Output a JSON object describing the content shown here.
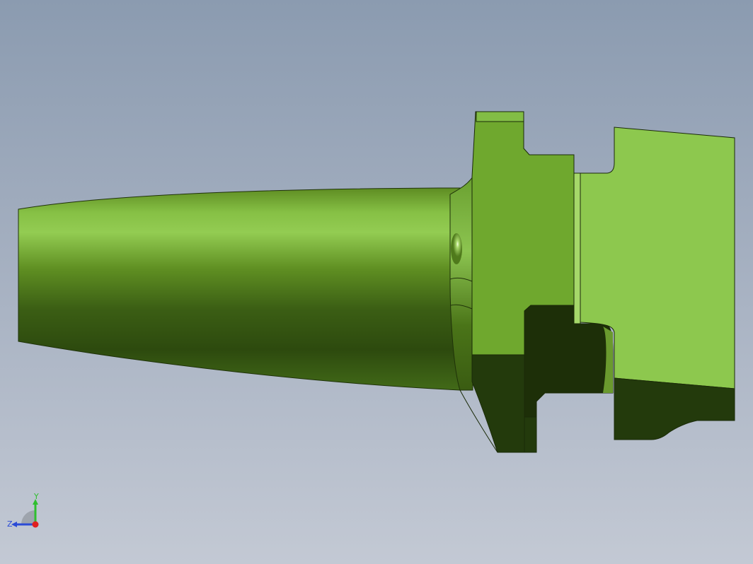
{
  "viewport": {
    "background_top": "#8b9bb0",
    "background_bottom": "#c3c9d4"
  },
  "model": {
    "name": "tool-holder-cone-part",
    "body_color_light": "#8dc44e",
    "body_color_mid": "#6fa32e",
    "body_color_dark": "#233a0c",
    "edge_color": "#1a2a08"
  },
  "triad": {
    "x_axis_label": "",
    "y_axis_label": "Y",
    "z_axis_label": "Z",
    "y_color": "#2fbf2f",
    "z_color": "#2b4bd6",
    "x_color": "#e02020"
  }
}
